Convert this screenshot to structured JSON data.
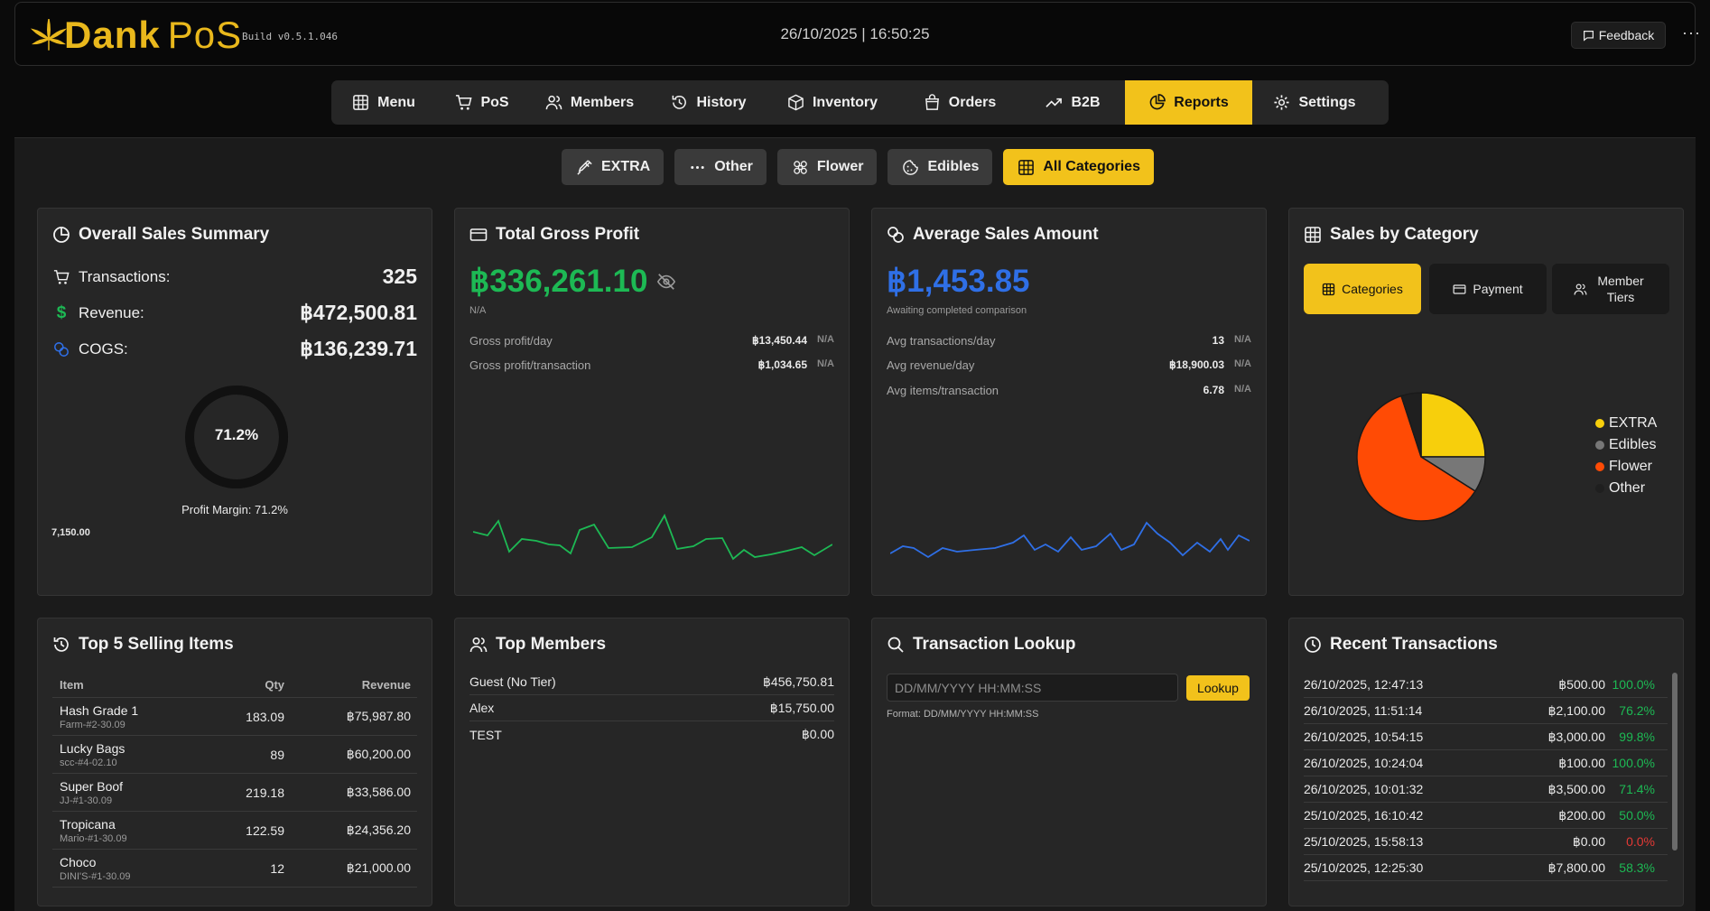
{
  "header": {
    "logo_bold": "Dank",
    "logo_light": "PoS",
    "build": "Build v0.5.1.046",
    "datetime": "26/10/2025 | 16:50:25",
    "feedback_label": "Feedback",
    "more_label": "···"
  },
  "nav": [
    {
      "label": "Menu",
      "icon": "grid-icon"
    },
    {
      "label": "PoS",
      "icon": "cart-icon"
    },
    {
      "label": "Members",
      "icon": "users-icon"
    },
    {
      "label": "History",
      "icon": "history-icon"
    },
    {
      "label": "Inventory",
      "icon": "box-icon"
    },
    {
      "label": "Orders",
      "icon": "bag-icon"
    },
    {
      "label": "B2B",
      "icon": "trending-icon"
    },
    {
      "label": "Reports",
      "icon": "pie-icon",
      "active": true
    },
    {
      "label": "Settings",
      "icon": "gear-icon"
    }
  ],
  "category_filters": [
    {
      "label": "EXTRA",
      "icon": "syringe-icon"
    },
    {
      "label": "Other",
      "icon": "dots-icon"
    },
    {
      "label": "Flower",
      "icon": "flower-icon"
    },
    {
      "label": "Edibles",
      "icon": "cookie-icon"
    },
    {
      "label": "All Categories",
      "icon": "grid-icon",
      "active": true
    }
  ],
  "overall": {
    "title": "Overall Sales Summary",
    "transactions_label": "Transactions:",
    "transactions": "325",
    "revenue_label": "Revenue:",
    "revenue": "฿472,500.81",
    "cogs_label": "COGS:",
    "cogs": "฿136,239.71",
    "margin_pct": 71.2,
    "margin_ring_text": "71.2%",
    "margin_label": "Profit Margin: 71.2%",
    "cut_value": "7,150.00"
  },
  "gross": {
    "title": "Total Gross Profit",
    "value": "฿336,261.10",
    "comparison": "N/A",
    "rows": [
      {
        "label": "Gross profit/day",
        "value": "฿13,450.44",
        "na": "N/A"
      },
      {
        "label": "Gross profit/transaction",
        "value": "฿1,034.65",
        "na": "N/A"
      }
    ],
    "spark_color": "#1db954"
  },
  "average": {
    "title": "Average Sales Amount",
    "value": "฿1,453.85",
    "comparison": "Awaiting completed comparison",
    "rows": [
      {
        "label": "Avg transactions/day",
        "value": "13",
        "na": "N/A"
      },
      {
        "label": "Avg revenue/day",
        "value": "฿18,900.03",
        "na": "N/A"
      },
      {
        "label": "Avg items/transaction",
        "value": "6.78",
        "na": "N/A"
      }
    ],
    "spark_color": "#2f6fe6"
  },
  "category": {
    "title": "Sales by Category",
    "tabs": [
      {
        "label": "Categories",
        "icon": "grid-icon",
        "active": true
      },
      {
        "label": "Payment",
        "icon": "card-icon"
      },
      {
        "label": "Member Tiers",
        "icon": "users-icon"
      }
    ]
  },
  "chart_data": {
    "type": "pie",
    "categories": [
      "EXTRA",
      "Edibles",
      "Flower",
      "Other"
    ],
    "values": [
      25,
      9,
      61,
      5
    ],
    "colors": [
      "#f7cf0c",
      "#777777",
      "#ff4b05",
      "#1f1f1f"
    ],
    "legend": "right"
  },
  "top_items": {
    "title": "Top 5 Selling Items",
    "headers": {
      "item": "Item",
      "qty": "Qty",
      "revenue": "Revenue"
    },
    "rows": [
      {
        "name": "Hash Grade 1",
        "code": "Farm-#2-30.09",
        "qty": "183.09",
        "revenue": "฿75,987.80"
      },
      {
        "name": "Lucky Bags",
        "code": "scc-#4-02.10",
        "qty": "89",
        "revenue": "฿60,200.00"
      },
      {
        "name": "Super Boof",
        "code": "JJ-#1-30.09",
        "qty": "219.18",
        "revenue": "฿33,586.00"
      },
      {
        "name": "Tropicana",
        "code": "Mario-#1-30.09",
        "qty": "122.59",
        "revenue": "฿24,356.20"
      },
      {
        "name": "Choco",
        "code": "DINI'S-#1-30.09",
        "qty": "12",
        "revenue": "฿21,000.00"
      }
    ]
  },
  "top_members": {
    "title": "Top Members",
    "rows": [
      {
        "name": "Guest (No Tier)",
        "amount": "฿456,750.81"
      },
      {
        "name": "Alex",
        "amount": "฿15,750.00"
      },
      {
        "name": "TEST",
        "amount": "฿0.00"
      }
    ]
  },
  "lookup": {
    "title": "Transaction Lookup",
    "placeholder": "DD/MM/YYYY HH:MM:SS",
    "button": "Lookup",
    "hint": "Format: DD/MM/YYYY HH:MM:SS"
  },
  "recent": {
    "title": "Recent Transactions",
    "rows": [
      {
        "time": "26/10/2025, 12:47:13",
        "amount": "฿500.00",
        "pct": "100.0%",
        "negative": false
      },
      {
        "time": "26/10/2025, 11:51:14",
        "amount": "฿2,100.00",
        "pct": "76.2%",
        "negative": false
      },
      {
        "time": "26/10/2025, 10:54:15",
        "amount": "฿3,000.00",
        "pct": "99.8%",
        "negative": false
      },
      {
        "time": "26/10/2025, 10:24:04",
        "amount": "฿100.00",
        "pct": "100.0%",
        "negative": false
      },
      {
        "time": "26/10/2025, 10:01:32",
        "amount": "฿3,500.00",
        "pct": "71.4%",
        "negative": false
      },
      {
        "time": "25/10/2025, 16:10:42",
        "amount": "฿200.00",
        "pct": "50.0%",
        "negative": false
      },
      {
        "time": "25/10/2025, 15:58:13",
        "amount": "฿0.00",
        "pct": "0.0%",
        "negative": true
      },
      {
        "time": "25/10/2025, 12:25:30",
        "amount": "฿7,800.00",
        "pct": "58.3%",
        "negative": false
      }
    ]
  },
  "colors": {
    "accent": "#f2c21b",
    "positive": "#1db954",
    "negative": "#e53935",
    "info": "#2f6fe6"
  }
}
